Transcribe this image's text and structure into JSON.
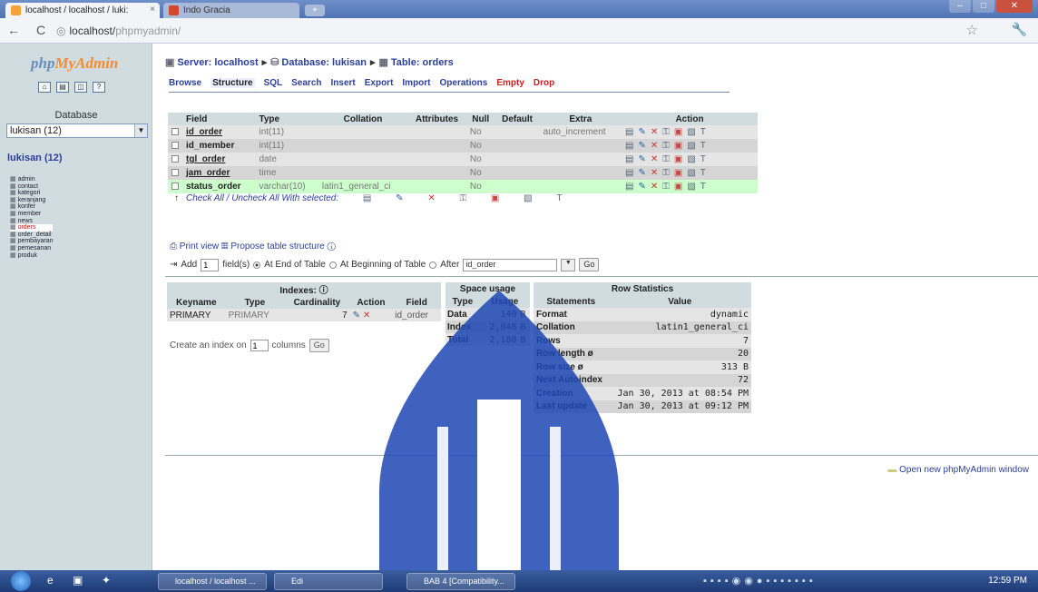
{
  "browser": {
    "tab_active": "localhost / localhost / luki:",
    "tab_inactive": "Indo Gracia",
    "url_host": "localhost/",
    "url_path": "phpmyadmin/"
  },
  "left": {
    "logo_php": "php",
    "logo_rest": "MyAdmin",
    "database_label": "Database",
    "db_select_value": "lukisan (12)",
    "db_link": "lukisan (12)",
    "tables": [
      "admin",
      "contact",
      "kategori",
      "keranjang",
      "konfer",
      "member",
      "news",
      "orders",
      "order_detail",
      "pembayaran",
      "pemesanan",
      "produk"
    ]
  },
  "breadcrumb": {
    "server": "Server: localhost",
    "database": "Database: lukisan",
    "table": "Table: orders"
  },
  "tabs": [
    "Browse",
    "Structure",
    "SQL",
    "Search",
    "Insert",
    "Export",
    "Import",
    "Operations",
    "Empty",
    "Drop"
  ],
  "structure": {
    "headers": [
      "Field",
      "Type",
      "Collation",
      "Attributes",
      "Null",
      "Default",
      "Extra",
      "Action"
    ],
    "rows": [
      {
        "field": "id_order",
        "type": "int(11)",
        "collation": "",
        "null": "No",
        "extra": "auto_increment"
      },
      {
        "field": "id_member",
        "type": "int(11)",
        "collation": "",
        "null": "No",
        "extra": ""
      },
      {
        "field": "tgl_order",
        "type": "date",
        "collation": "",
        "null": "No",
        "extra": ""
      },
      {
        "field": "jam_order",
        "type": "time",
        "collation": "",
        "null": "No",
        "extra": ""
      },
      {
        "field": "status_order",
        "type": "varchar(10)",
        "collation": "latin1_general_ci",
        "null": "No",
        "extra": ""
      }
    ],
    "check_all": "Check All / Uncheck All",
    "with_selected": "With selected:"
  },
  "links": {
    "print_view": "Print view",
    "propose": "Propose table structure"
  },
  "add_row": {
    "add_label": "Add",
    "add_count": "1",
    "fields_label": "field(s)",
    "end_label": "At End of Table",
    "begin_label": "At Beginning of Table",
    "after_label": "After",
    "after_value": "id_order",
    "go": "Go"
  },
  "indexes": {
    "title": "Indexes:",
    "headers": [
      "Keyname",
      "Type",
      "Cardinality",
      "Action",
      "Field"
    ],
    "row": {
      "keyname": "PRIMARY",
      "type": "PRIMARY",
      "cardinality": "7",
      "field": "id_order"
    },
    "create_label": "Create an index on",
    "create_value": "1",
    "columns_label": "columns",
    "go": "Go"
  },
  "space": {
    "title": "Space usage",
    "headers": [
      "Type",
      "Usage"
    ],
    "rows": [
      {
        "type": "Data",
        "value": "140",
        "unit": "B"
      },
      {
        "type": "Index",
        "value": "2,048",
        "unit": "B"
      },
      {
        "type": "Total",
        "value": "2,188",
        "unit": "B"
      }
    ]
  },
  "row_stats": {
    "title": "Row Statistics",
    "headers": [
      "Statements",
      "Value"
    ],
    "rows": [
      {
        "k": "Format",
        "v": "dynamic"
      },
      {
        "k": "Collation",
        "v": "latin1_general_ci"
      },
      {
        "k": "Rows",
        "v": "7"
      },
      {
        "k": "Row length ø",
        "v": "20"
      },
      {
        "k": "Row size ø",
        "v": "313 B"
      },
      {
        "k": "Next Autoindex",
        "v": "72"
      },
      {
        "k": "Creation",
        "v": "Jan 30, 2013 at 08:54 PM"
      },
      {
        "k": "Last update",
        "v": "Jan 30, 2013 at 09:12 PM"
      }
    ]
  },
  "open_new": "Open new phpMyAdmin window",
  "taskbar": {
    "task1": "localhost / localhost ...",
    "task2": "Edi",
    "task3": "BAB 4 [Compatibility...",
    "clock": "12:59 PM"
  },
  "colors": {
    "link": "#2b3f9b",
    "header_bg": "#d0dce0",
    "highlight_row": "#ccffcc",
    "watermark": "#1e46b4"
  }
}
